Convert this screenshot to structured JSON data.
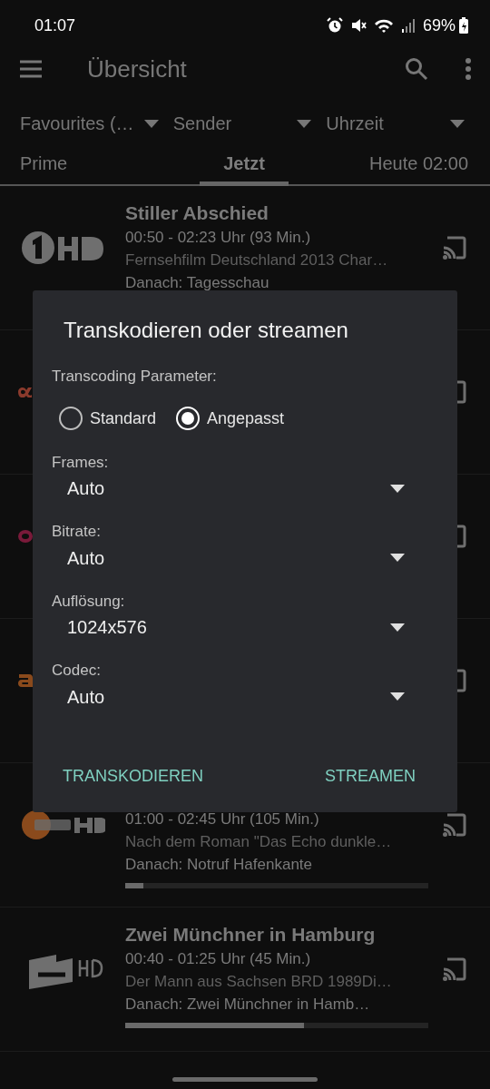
{
  "status_bar": {
    "time": "01:07",
    "battery": "69%"
  },
  "app_bar": {
    "title": "Übersicht"
  },
  "filters": [
    {
      "label": "Favourites (…"
    },
    {
      "label": "Sender"
    },
    {
      "label": "Uhrzeit"
    }
  ],
  "tabs": [
    {
      "label": "Prime",
      "selected": false
    },
    {
      "label": "Jetzt",
      "selected": true
    },
    {
      "label": "Heute 02:00",
      "selected": false
    }
  ],
  "programs": [
    {
      "kind": "one",
      "color": "#6f6f6f",
      "title": "Stiller Abschied",
      "time": "00:50 - 02:23 Uhr (93 Min.)",
      "description": "Fernsehfilm Deutschland 2013 Char…",
      "next": "Danach: Tagesschau"
    },
    {
      "kind": "arte",
      "color": "#8a3a2c"
    },
    {
      "kind": "ring",
      "color": "#7a1a3a"
    },
    {
      "kind": "letter",
      "color": "#8a4a1c"
    },
    {
      "kind": "zdf",
      "color": "#8a4a1c",
      "time": "01:00 - 02:45 Uhr (105 Min.)",
      "description": "Nach dem Roman \"Das Echo dunkle…",
      "next": "Danach: Notruf Hafenkante",
      "level": 0.06
    },
    {
      "kind": "neo",
      "color": "#6f6f6f",
      "title": "Zwei Münchner in Hamburg",
      "time": "00:40 - 01:25 Uhr (45 Min.)",
      "description": "Der Mann aus Sachsen BRD 1989Di…",
      "next": "Danach: Zwei Münchner in Hamb…",
      "level": 0.59
    }
  ],
  "dialog": {
    "title": "Transkodieren oder streamen",
    "section_label": "Transcoding Parameter:",
    "options": [
      {
        "label": "Standard",
        "selected": false
      },
      {
        "label": "Angepasst",
        "selected": true
      }
    ],
    "fields": [
      {
        "label": "Frames:",
        "value": "Auto"
      },
      {
        "label": "Bitrate:",
        "value": "Auto"
      },
      {
        "label": "Auflösung:",
        "value": "1024x576"
      },
      {
        "label": "Codec:",
        "value": "Auto"
      }
    ],
    "buttons": [
      {
        "label": "TRANSKODIEREN"
      },
      {
        "label": "STREAMEN"
      }
    ]
  }
}
